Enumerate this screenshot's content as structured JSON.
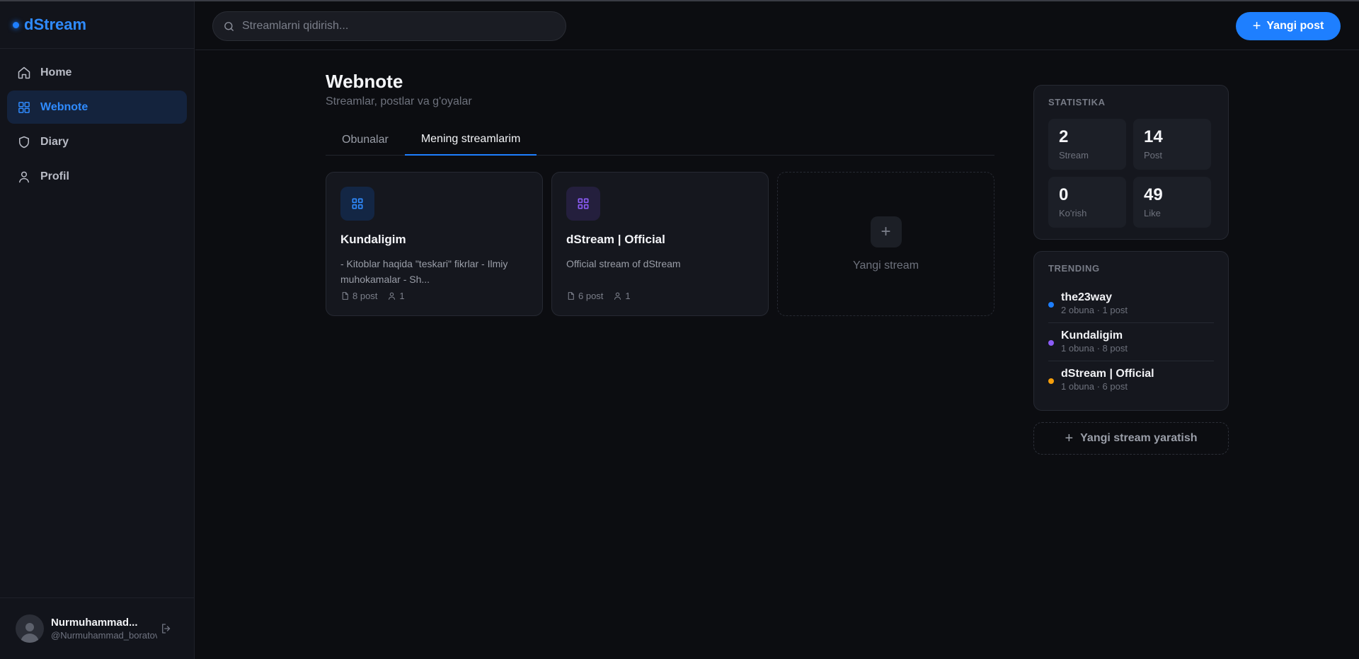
{
  "brand": {
    "name": "dStream",
    "accent": "#1e7fff"
  },
  "sidebar": {
    "items": [
      {
        "label": "Home",
        "icon": "home-icon",
        "active": false
      },
      {
        "label": "Webnote",
        "icon": "grid-icon",
        "active": true
      },
      {
        "label": "Diary",
        "icon": "shield-icon",
        "active": false
      },
      {
        "label": "Profil",
        "icon": "user-icon",
        "active": false
      }
    ],
    "user": {
      "name": "Nurmuhammad...",
      "handle": "@Nurmuhammad_boratov"
    }
  },
  "header": {
    "search_placeholder": "Streamlarni qidirish...",
    "new_post_label": "Yangi post"
  },
  "main": {
    "title": "Webnote",
    "subtitle": "Streamlar, postlar va g'oyalar",
    "tabs": [
      {
        "label": "Obunalar",
        "active": false
      },
      {
        "label": "Mening streamlarim",
        "active": true
      }
    ],
    "cards": [
      {
        "title": "Kundaligim",
        "description": "- Kitoblar haqida \"teskari\" fikrlar - Ilmiy muhokamalar - Sh...",
        "posts": "8 post",
        "subscribers": "1",
        "icon_color": "#2f8bff",
        "icon_bg": "#132644"
      },
      {
        "title": "dStream | Official",
        "description": "Official stream of dStream",
        "posts": "6 post",
        "subscribers": "1",
        "icon_color": "#8b5cf6",
        "icon_bg": "#241f3d"
      }
    ],
    "new_stream_label": "Yangi stream"
  },
  "stats": {
    "title": "STATISTIKA",
    "items": [
      {
        "value": "2",
        "label": "Stream"
      },
      {
        "value": "14",
        "label": "Post"
      },
      {
        "value": "0",
        "label": "Ko'rish"
      },
      {
        "value": "49",
        "label": "Like"
      }
    ]
  },
  "trending": {
    "title": "TRENDING",
    "items": [
      {
        "name": "the23way",
        "meta": "2 obuna · 1 post",
        "color": "#1e7fff"
      },
      {
        "name": "Kundaligim",
        "meta": "1 obuna · 8 post",
        "color": "#8b5cf6"
      },
      {
        "name": "dStream | Official",
        "meta": "1 obuna · 6 post",
        "color": "#f59e0b"
      }
    ]
  },
  "create_stream_label": "Yangi stream yaratish"
}
